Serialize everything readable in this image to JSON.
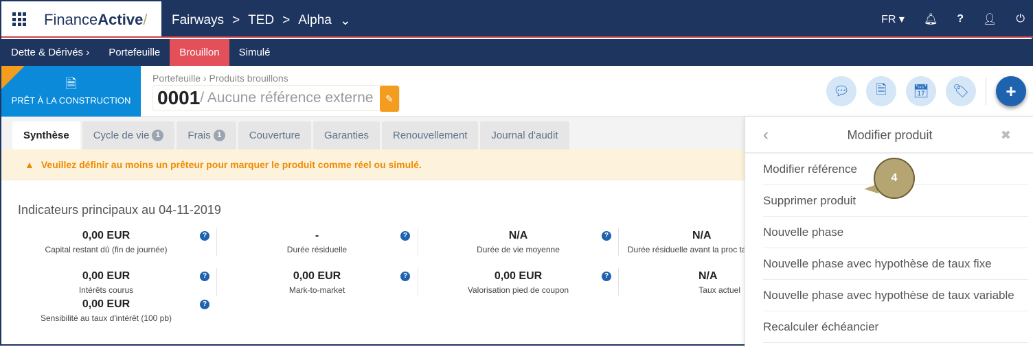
{
  "topbar": {
    "brand_regular": "Finance",
    "brand_bold": "Active",
    "crumbs": [
      "Fairways",
      ">",
      "TED",
      ">",
      "Alpha"
    ],
    "lang": "FR"
  },
  "nav": {
    "section": "Dette & Dérivés ›",
    "items": [
      "Portefeuille",
      "Brouillon",
      "Simulé"
    ],
    "active": "Brouillon"
  },
  "header": {
    "card_label": "PRÊT À LA CONSTRUCTION",
    "breadcrumb": "Portefeuille › Produits brouillons",
    "ref_number": "0001",
    "ref_text": "/ Aucune référence externe"
  },
  "tabs": [
    {
      "label": "Synthèse",
      "active": true
    },
    {
      "label": "Cycle de vie",
      "badge": "1"
    },
    {
      "label": "Frais",
      "badge": "1"
    },
    {
      "label": "Couverture"
    },
    {
      "label": "Garanties"
    },
    {
      "label": "Renouvellement"
    },
    {
      "label": "Journal d'audit"
    }
  ],
  "warning": "Veuillez définir au moins un prêteur pour marquer le produit comme réel ou simulé.",
  "section_title": "Indicateurs principaux au 04-11-2019",
  "indicators": [
    {
      "value": "0,00 EUR",
      "label": "Capital restant dû (fin de journée)"
    },
    {
      "value": "-",
      "label": "Durée résiduelle"
    },
    {
      "value": "N/A",
      "label": "Durée de vie moyenne"
    },
    {
      "value": "N/A",
      "label": "Durée résiduelle avant la proc taux"
    },
    {
      "value": "0,00 EUR",
      "label": "Intérêts courus"
    },
    {
      "value": "0,00 EUR",
      "label": "Mark-to-market"
    },
    {
      "value": "0,00 EUR",
      "label": "Valorisation pied de coupon"
    },
    {
      "value": "N/A",
      "label": "Taux actuel"
    },
    {
      "value": "0,00 EUR",
      "label": "Sensibilité au taux d'intérêt (100 pb)"
    }
  ],
  "panel": {
    "title": "Modifier produit",
    "items": [
      "Modifier référence",
      "Supprimer produit",
      "Nouvelle phase",
      "Nouvelle phase avec hypothèse de taux fixe",
      "Nouvelle phase avec hypothèse de taux variable",
      "Recalculer échéancier"
    ]
  },
  "callout": "4",
  "colors": {
    "navy": "#1e3560",
    "active_tab": "#e4505a",
    "card": "#0a8ad8",
    "orange": "#f39c1e"
  }
}
